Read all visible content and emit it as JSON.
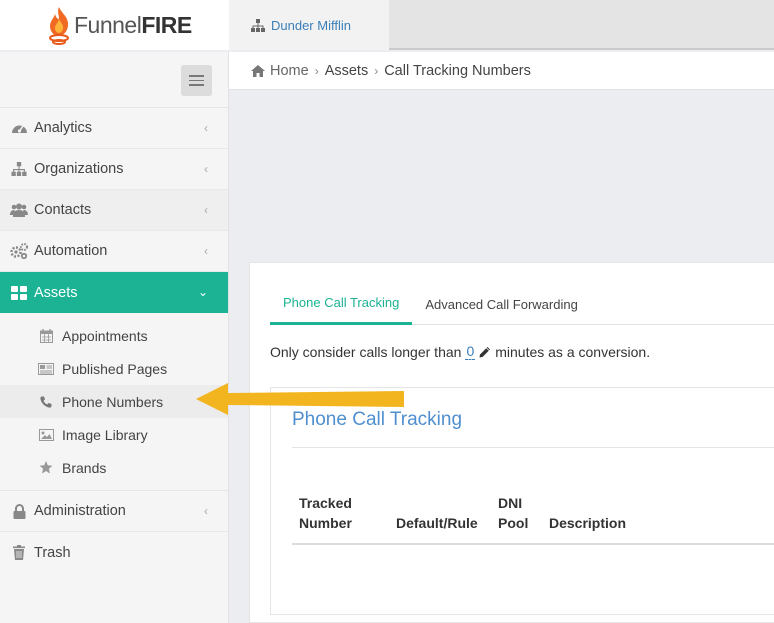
{
  "brand": {
    "name_light": "Funnel",
    "name_bold": "FIRE"
  },
  "org": {
    "name": "Dunder Mifflin"
  },
  "breadcrumb": {
    "home": "Home",
    "section": "Assets",
    "page": "Call Tracking Numbers"
  },
  "sidebar": {
    "items": [
      {
        "label": "Analytics",
        "icon": "dashboard-icon"
      },
      {
        "label": "Organizations",
        "icon": "sitemap-icon"
      },
      {
        "label": "Contacts",
        "icon": "users-icon"
      },
      {
        "label": "Automation",
        "icon": "gears-icon"
      },
      {
        "label": "Assets",
        "icon": "grid-icon",
        "active": true
      }
    ],
    "sub_items": [
      {
        "label": "Appointments",
        "icon": "calendar-icon"
      },
      {
        "label": "Published Pages",
        "icon": "newspaper-icon"
      },
      {
        "label": "Phone Numbers",
        "icon": "phone-icon",
        "current": true
      },
      {
        "label": "Image Library",
        "icon": "image-icon"
      },
      {
        "label": "Brands",
        "icon": "star-icon"
      }
    ],
    "bottom_items": [
      {
        "label": "Administration",
        "icon": "lock-icon"
      },
      {
        "label": "Trash",
        "icon": "trash-icon"
      }
    ]
  },
  "tabs": [
    {
      "label": "Phone Call Tracking",
      "active": true
    },
    {
      "label": "Advanced Call Forwarding",
      "active": false
    }
  ],
  "setting": {
    "prefix": "Only consider calls longer than",
    "value": "0",
    "suffix": "minutes as a conversion."
  },
  "section_title": "Phone Call Tracking",
  "table": {
    "headers": {
      "tracked_1": "Tracked",
      "tracked_2": "Number",
      "default_rule": "Default/Rule",
      "dni_1": "DNI",
      "dni_2": "Pool",
      "description": "Description"
    }
  },
  "colors": {
    "accent": "#1bb394",
    "link": "#3c7fb8",
    "title": "#4f8fcf",
    "arrow": "#f2b51f"
  }
}
